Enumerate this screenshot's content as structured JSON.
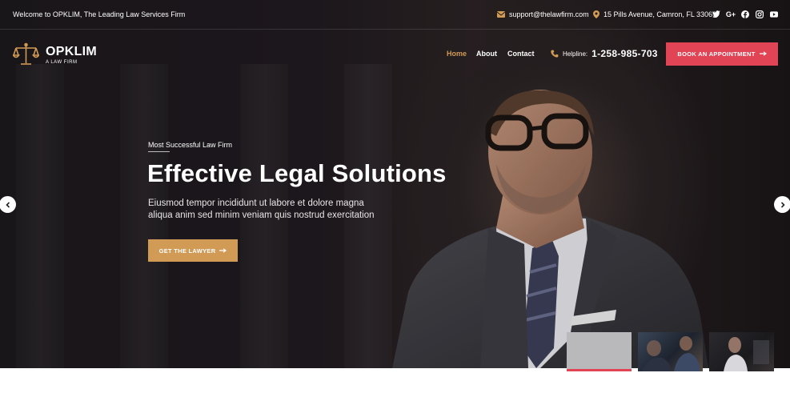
{
  "topbar": {
    "welcome": "Welcome to OPKLIM, The Leading Law Services Firm",
    "email": "support@thelawfirm.com",
    "address": "15 Pills Avenue, Camron, FL 33069",
    "social": [
      "twitter-icon",
      "google-plus-icon",
      "facebook-icon",
      "instagram-icon",
      "youtube-icon"
    ]
  },
  "logo": {
    "name": "OPKLIM",
    "tagline": "A LAW FIRM"
  },
  "nav": {
    "items": [
      "Home",
      "About",
      "Contact"
    ],
    "active": "Home"
  },
  "helpline": {
    "label": "Helpline:",
    "number": "1-258-985-703"
  },
  "book_button": {
    "label": "BOOK AN APPOINTMENT"
  },
  "hero": {
    "eyebrow": "Most Successful Law Firm",
    "headline": "Effective Legal Solutions",
    "description": "Eiusmod tempor incididunt ut labore et dolore magna aliqua anim sed minim veniam quis nostrud exercitation",
    "cta": "GET THE LAWYER"
  },
  "slider": {
    "prev_icon": "chevron-left-icon",
    "next_icon": "chevron-right-icon",
    "thumbnails": 3,
    "active_thumbnail": 1
  },
  "colors": {
    "accent_gold": "#d19a55",
    "accent_red": "#e04455"
  }
}
